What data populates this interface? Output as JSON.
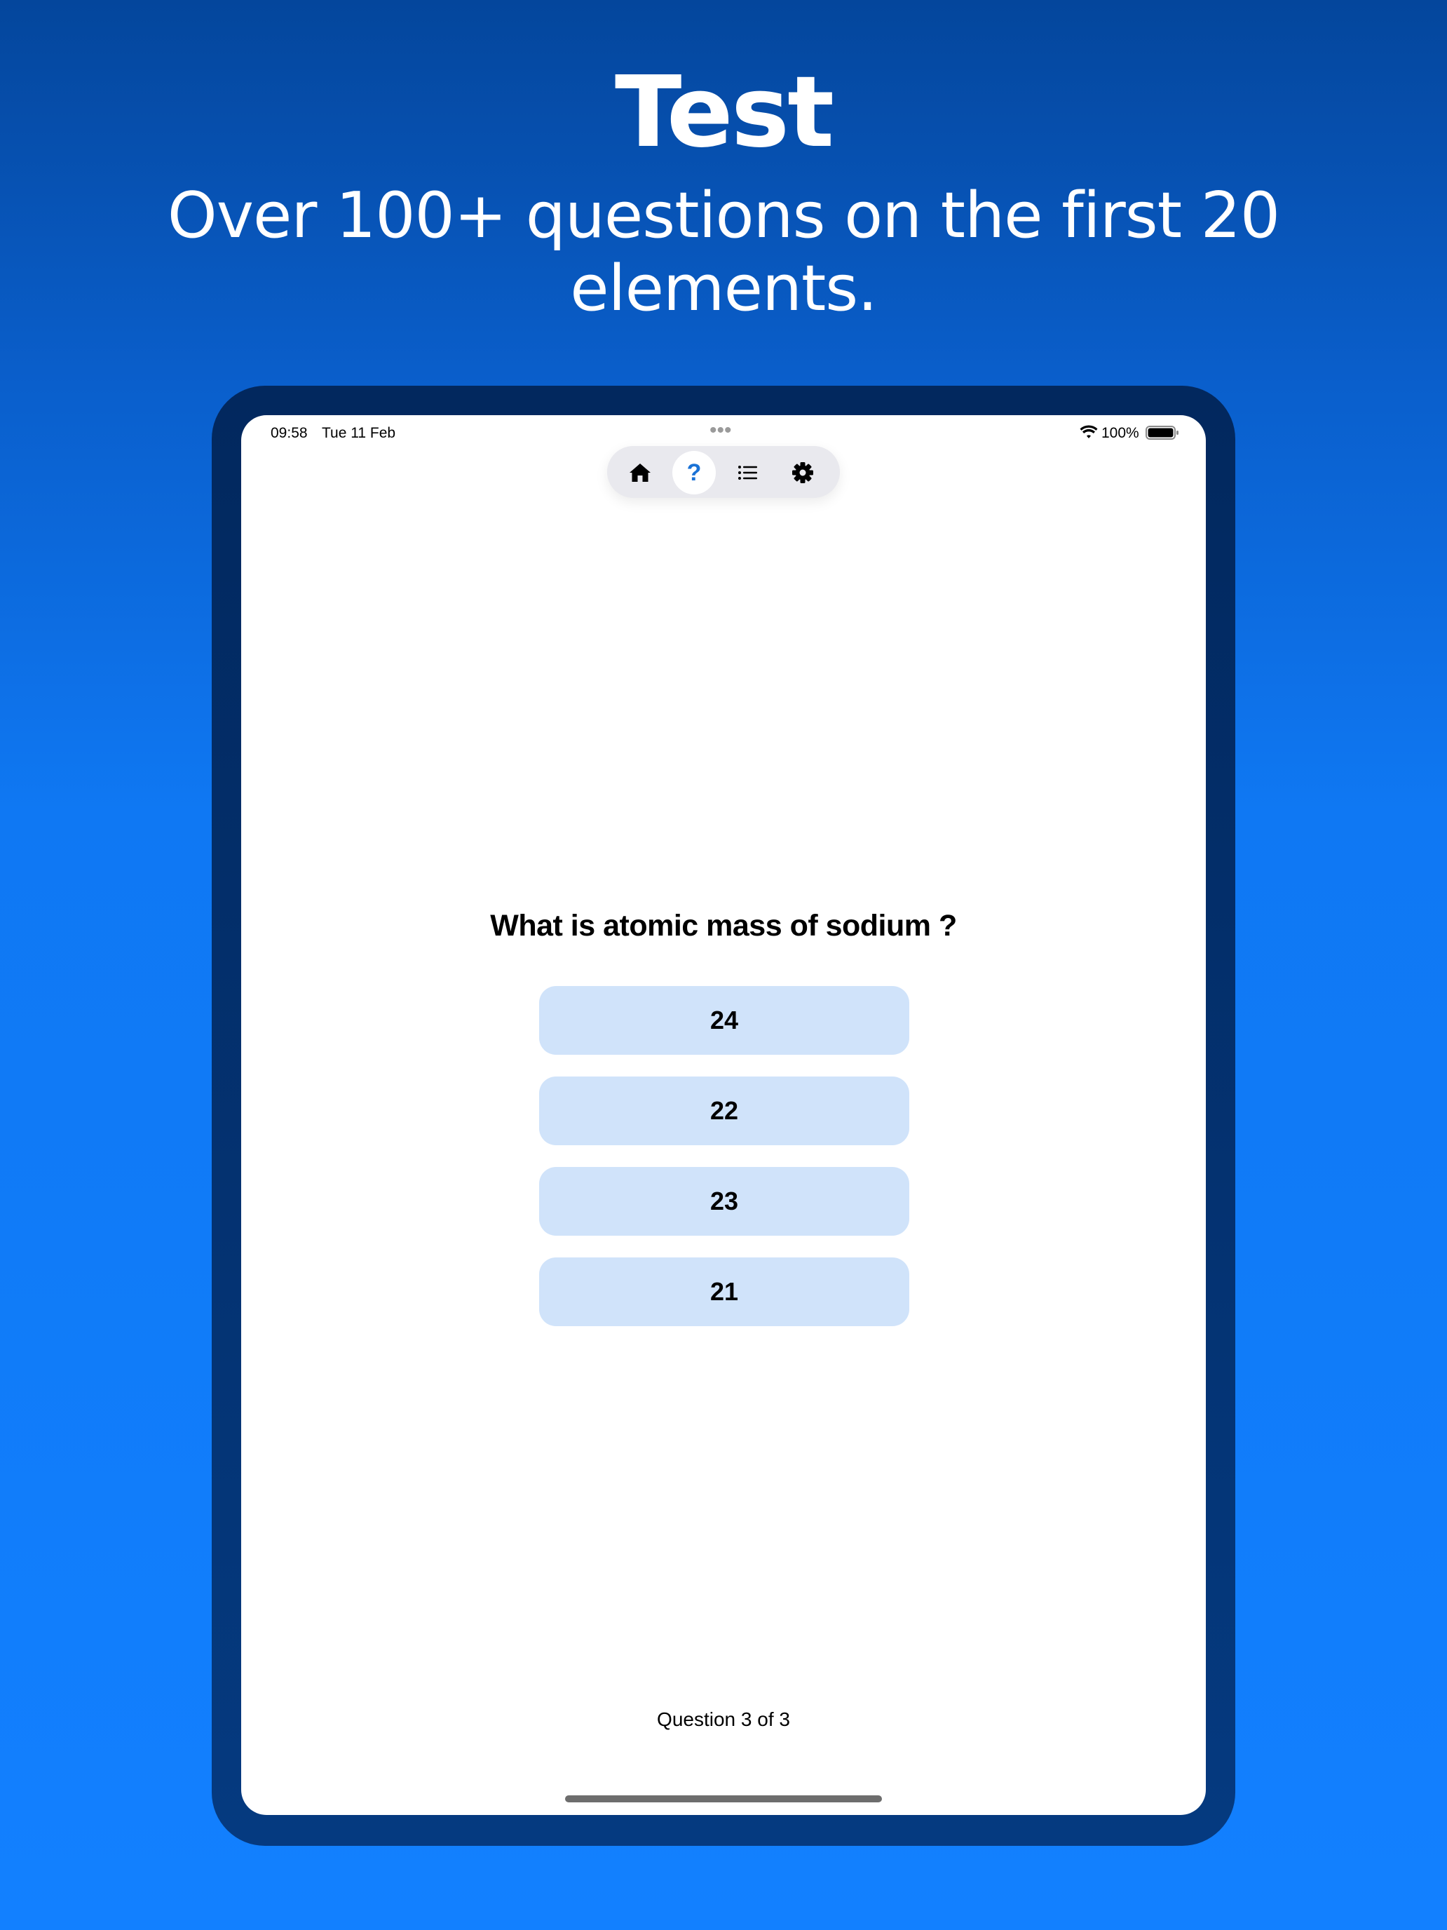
{
  "hero": {
    "title": "Test",
    "subtitle": "Over 100+ questions on the first 20 elements."
  },
  "status_bar": {
    "time": "09:58",
    "date": "Tue 11 Feb",
    "battery": "100%"
  },
  "nav": {
    "items": [
      {
        "icon": "home-icon",
        "active": false
      },
      {
        "icon": "question-mark-icon",
        "active": true,
        "glyph": "?"
      },
      {
        "icon": "list-icon",
        "active": false
      },
      {
        "icon": "gear-icon",
        "active": false
      }
    ]
  },
  "quiz": {
    "question": "What is atomic mass of sodium ?",
    "answers": [
      "24",
      "22",
      "23",
      "21"
    ],
    "progress": "Question 3 of 3"
  },
  "colors": {
    "answer_bg": "#d0e3fa",
    "accent": "#1a72d6",
    "background_top": "#04469c",
    "background_bottom": "#1280ff"
  }
}
